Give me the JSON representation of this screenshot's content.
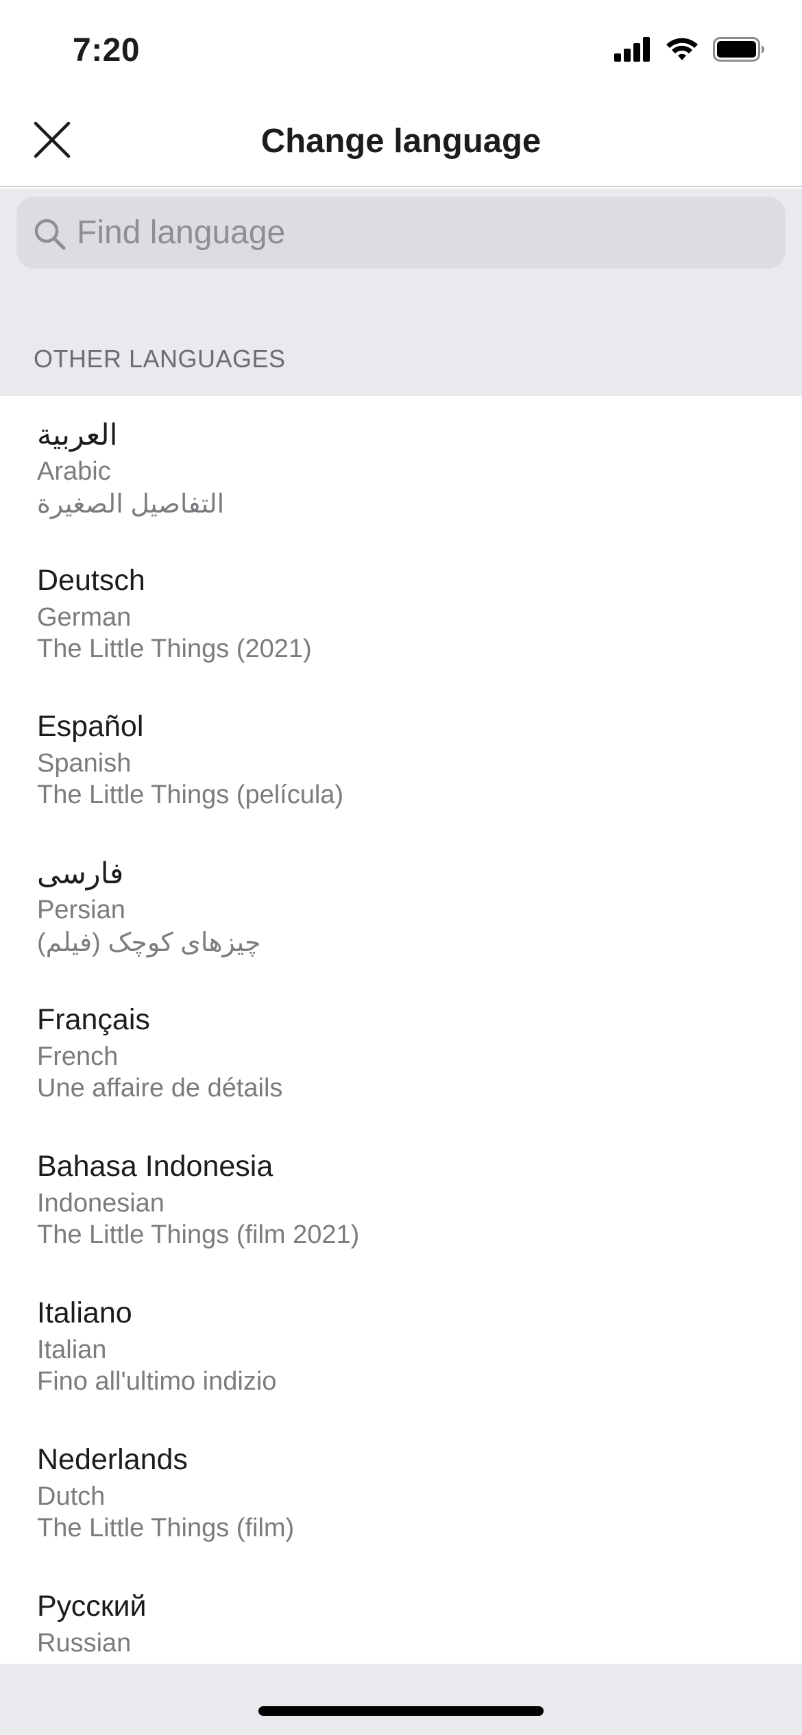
{
  "status_bar": {
    "time": "7:20",
    "icons": [
      "cellular-signal-icon",
      "wifi-icon",
      "battery-icon"
    ]
  },
  "header": {
    "title": "Change language",
    "close_icon": "close-icon"
  },
  "search": {
    "placeholder": "Find language",
    "value": "",
    "icon": "search-icon"
  },
  "section": {
    "header": "OTHER LANGUAGES"
  },
  "languages": [
    {
      "native": "العربية",
      "english": "Arabic",
      "title": "التفاصيل الصغيرة"
    },
    {
      "native": "Deutsch",
      "english": "German",
      "title": "The Little Things (2021)"
    },
    {
      "native": "Español",
      "english": "Spanish",
      "title": "The Little Things (película)"
    },
    {
      "native": "فارسی",
      "english": "Persian",
      "title": "چیزهای کوچک (فیلم)"
    },
    {
      "native": "Français",
      "english": "French",
      "title": "Une affaire de détails"
    },
    {
      "native": "Bahasa Indonesia",
      "english": "Indonesian",
      "title": "The Little Things (film 2021)"
    },
    {
      "native": "Italiano",
      "english": "Italian",
      "title": "Fino all'ultimo indizio"
    },
    {
      "native": "Nederlands",
      "english": "Dutch",
      "title": "The Little Things (film)"
    },
    {
      "native": "Русский",
      "english": "Russian",
      "title": ""
    }
  ],
  "colors": {
    "primary_text": "#1c1c1e",
    "secondary_text": "#7b7b80",
    "section_background": "#e9eaee",
    "search_background": "#dcdde2"
  }
}
